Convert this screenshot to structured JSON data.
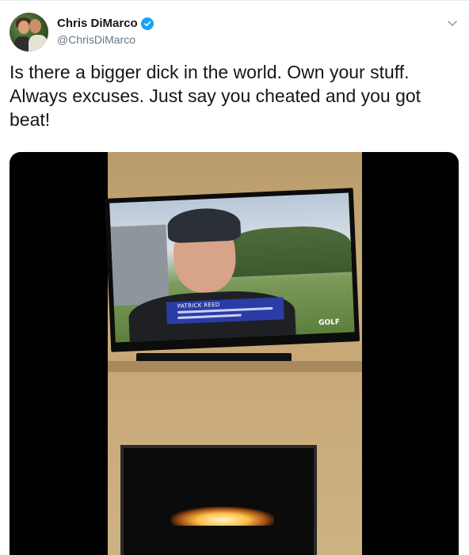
{
  "tweet": {
    "display_name": "Chris DiMarco",
    "handle": "@ChrisDiMarco",
    "verified": true,
    "text_lines": [
      "Is there a bigger dick in the world. Own your stuff.",
      "Always excuses. Just say you cheated and you got",
      "beat!"
    ]
  },
  "media": {
    "tv_lower_third_name": "PATRICK REED",
    "tv_network_logo": "GOLF"
  },
  "icons": {
    "verified": "verified-check-icon",
    "menu": "chevron-down-icon"
  },
  "colors": {
    "verified_blue": "#1da1f2",
    "handle_gray": "#657786",
    "text": "#14171a"
  }
}
